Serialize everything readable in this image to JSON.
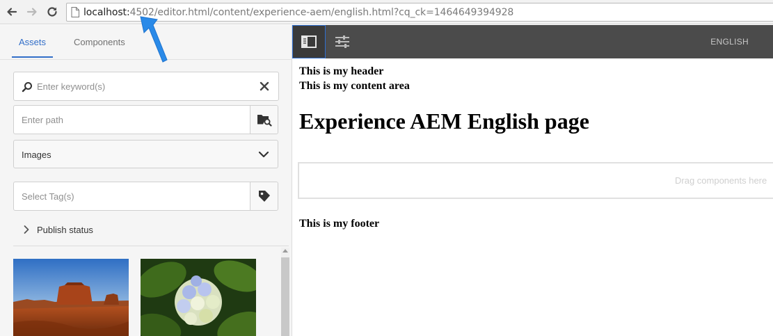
{
  "browser": {
    "url_host": "localhost:",
    "url_rest": "4502/editor.html/content/experience-aem/english.html?cq_ck=1464649394928"
  },
  "side_panel": {
    "tabs": [
      {
        "label": "Assets",
        "active": true
      },
      {
        "label": "Components",
        "active": false
      }
    ],
    "search": {
      "placeholder": "Enter keyword(s)"
    },
    "path": {
      "placeholder": "Enter path"
    },
    "asset_type": {
      "selected": "Images"
    },
    "tags": {
      "placeholder": "Select Tag(s)"
    },
    "publish_status": {
      "label": "Publish status"
    },
    "assets": [
      {
        "icon": "desert-landscape-image"
      },
      {
        "icon": "hydrangea-flower-image"
      }
    ]
  },
  "editor": {
    "language": "ENGLISH",
    "page": {
      "header": "This is my header",
      "content": "This is my content area",
      "heading": "Experience AEM English page",
      "drop_zone": "Drag components here",
      "footer": "This is my footer"
    }
  },
  "colors": {
    "accent": "#326ec8",
    "toolbar": "#4b4b4b",
    "annotation_arrow": "#2a8ae8"
  }
}
